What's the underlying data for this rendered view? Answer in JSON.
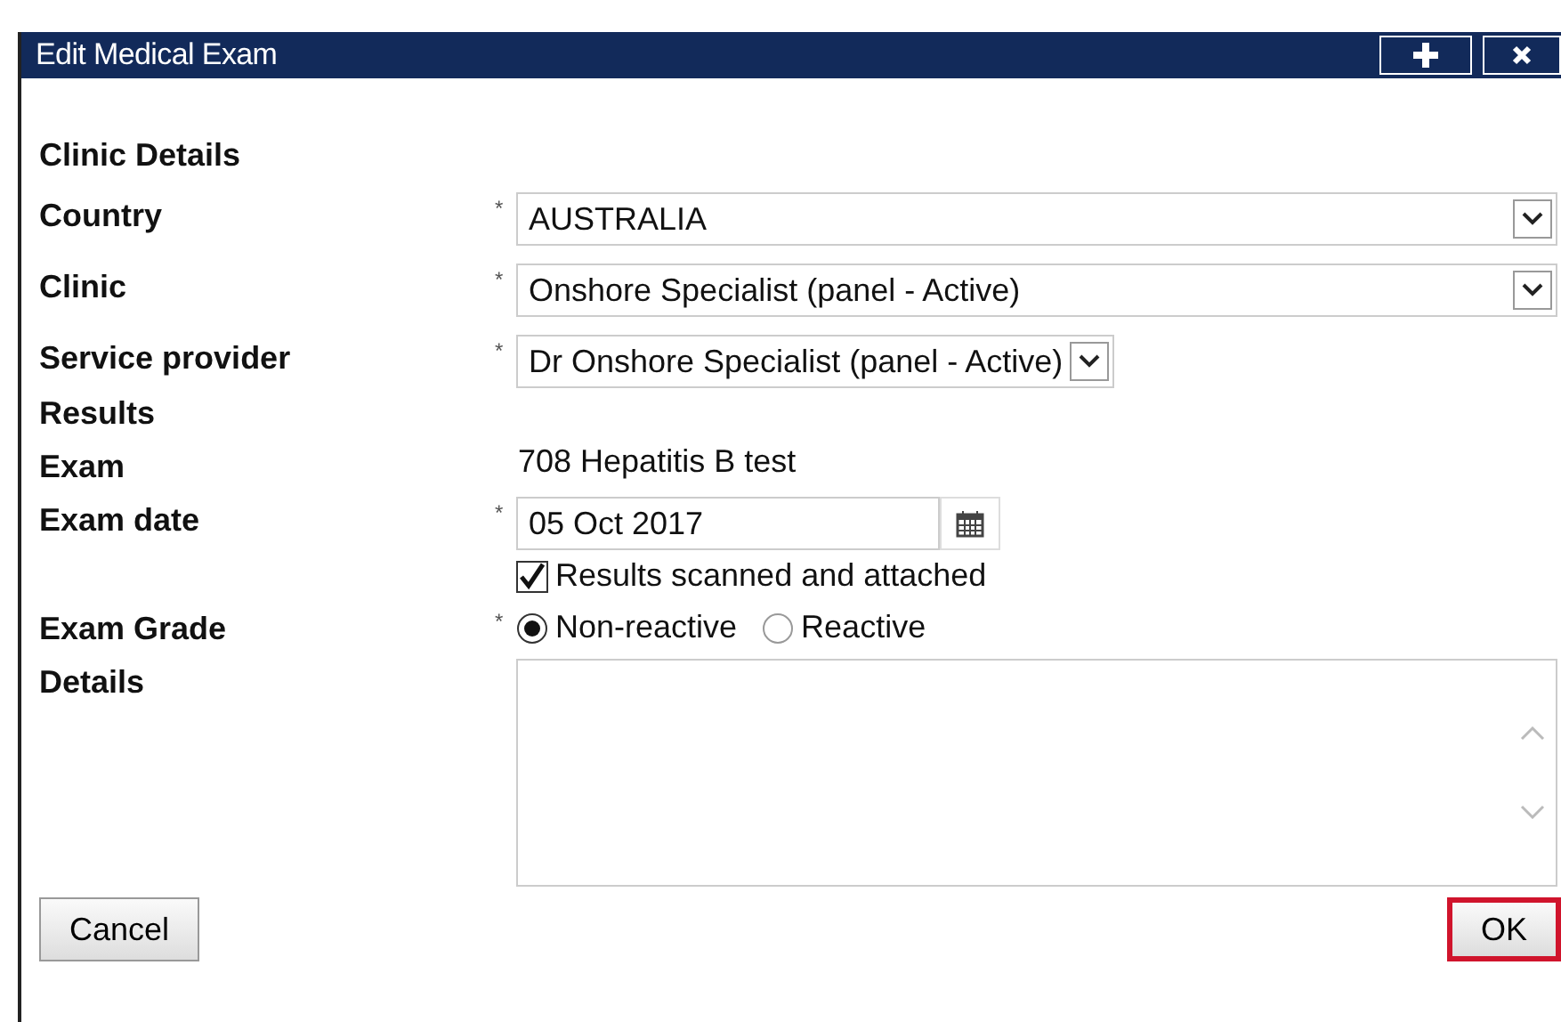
{
  "window": {
    "title": "Edit Medical Exam"
  },
  "fields": [
    {
      "kind": "section",
      "label": "Clinic Details"
    },
    {
      "kind": "select",
      "label": "Country",
      "marker": "*",
      "value": "AUSTRALIA"
    },
    {
      "kind": "select",
      "label": "Clinic",
      "marker": "*",
      "value": "Onshore Specialist (panel - Active)"
    },
    {
      "kind": "inline-select",
      "label": "Service provider",
      "marker": "*",
      "value": "Dr Onshore Specialist (panel - Active)"
    },
    {
      "kind": "section",
      "label": "Results"
    },
    {
      "kind": "text",
      "label": "Exam",
      "value": "708 Hepatitis B test"
    },
    {
      "kind": "date",
      "label": "Exam date",
      "marker": "*",
      "value": "05 Oct 2017"
    },
    {
      "kind": "checkbox",
      "text": "Results scanned and attached",
      "checked": true
    },
    {
      "kind": "radio",
      "label": "Exam Grade",
      "marker": "*",
      "options": [
        {
          "label": "Non-reactive",
          "selected": true
        },
        {
          "label": "Reactive",
          "selected": false
        }
      ]
    },
    {
      "kind": "textarea",
      "label": "Details"
    }
  ],
  "buttons": [
    {
      "label": "Cancel",
      "highlighted": false
    },
    {
      "label": "OK",
      "highlighted": true
    }
  ]
}
